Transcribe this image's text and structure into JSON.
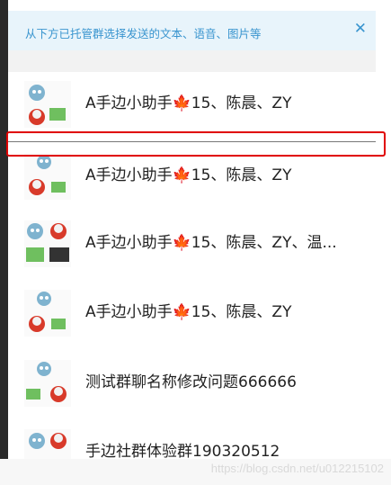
{
  "banner": {
    "text": "从下方已托管群选择发送的文本、语音、图片等",
    "close_icon": "close-icon"
  },
  "groups": [
    {
      "title": "A手边小助手🍁15、陈晨、ZY"
    },
    {
      "title": "A手边小助手🍁15、陈晨、ZY"
    },
    {
      "title": "A手边小助手🍁15、陈晨、ZY、温..."
    },
    {
      "title": "A手边小助手🍁15、陈晨、ZY"
    },
    {
      "title": "测试群聊名称修改问题666666"
    },
    {
      "title": "手边社群体验群190320512"
    }
  ],
  "watermark": "https://blog.csdn.net/u012215102",
  "colors": {
    "accent": "#3a95cf",
    "highlight": "#e00000"
  }
}
